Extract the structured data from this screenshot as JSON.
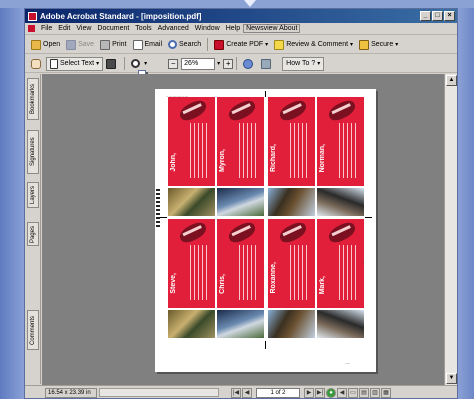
{
  "window": {
    "title": "Adobe Acrobat Standard - [imposition.pdf]",
    "controls": [
      "_",
      "□",
      "×"
    ]
  },
  "menubar": {
    "items": [
      "File",
      "Edit",
      "View",
      "Document",
      "Tools",
      "Advanced",
      "Window",
      "Help",
      "Newsview About"
    ]
  },
  "toolbar1": {
    "open": "Open",
    "save": "Save",
    "print": "Print",
    "email": "Email",
    "search": "Search",
    "create_pdf": "Create PDF",
    "review_comment": "Review & Comment",
    "secure": "Secure"
  },
  "toolbar2": {
    "select_text": "Select Text",
    "zoom_value": "26%",
    "how_to": "How To ?"
  },
  "side_tabs": {
    "bookmarks": "Bookmarks",
    "signatures": "Signatures",
    "layers": "Layers",
    "pages": "Pages",
    "comments": "Comments"
  },
  "document": {
    "cards": [
      {
        "name": "John,"
      },
      {
        "name": "Myron,"
      },
      {
        "name": "Richard,"
      },
      {
        "name": "Norman,"
      },
      {
        "name": "Steve,"
      },
      {
        "name": "Chris,"
      },
      {
        "name": "Roxanne,"
      },
      {
        "name": "Mark,"
      }
    ]
  },
  "status": {
    "page_size": "16.54 x 23.39 in",
    "page_indicator": "1 of 2"
  },
  "colors": {
    "card_red": "#e11f3a",
    "titlebar": "#0a246a"
  }
}
